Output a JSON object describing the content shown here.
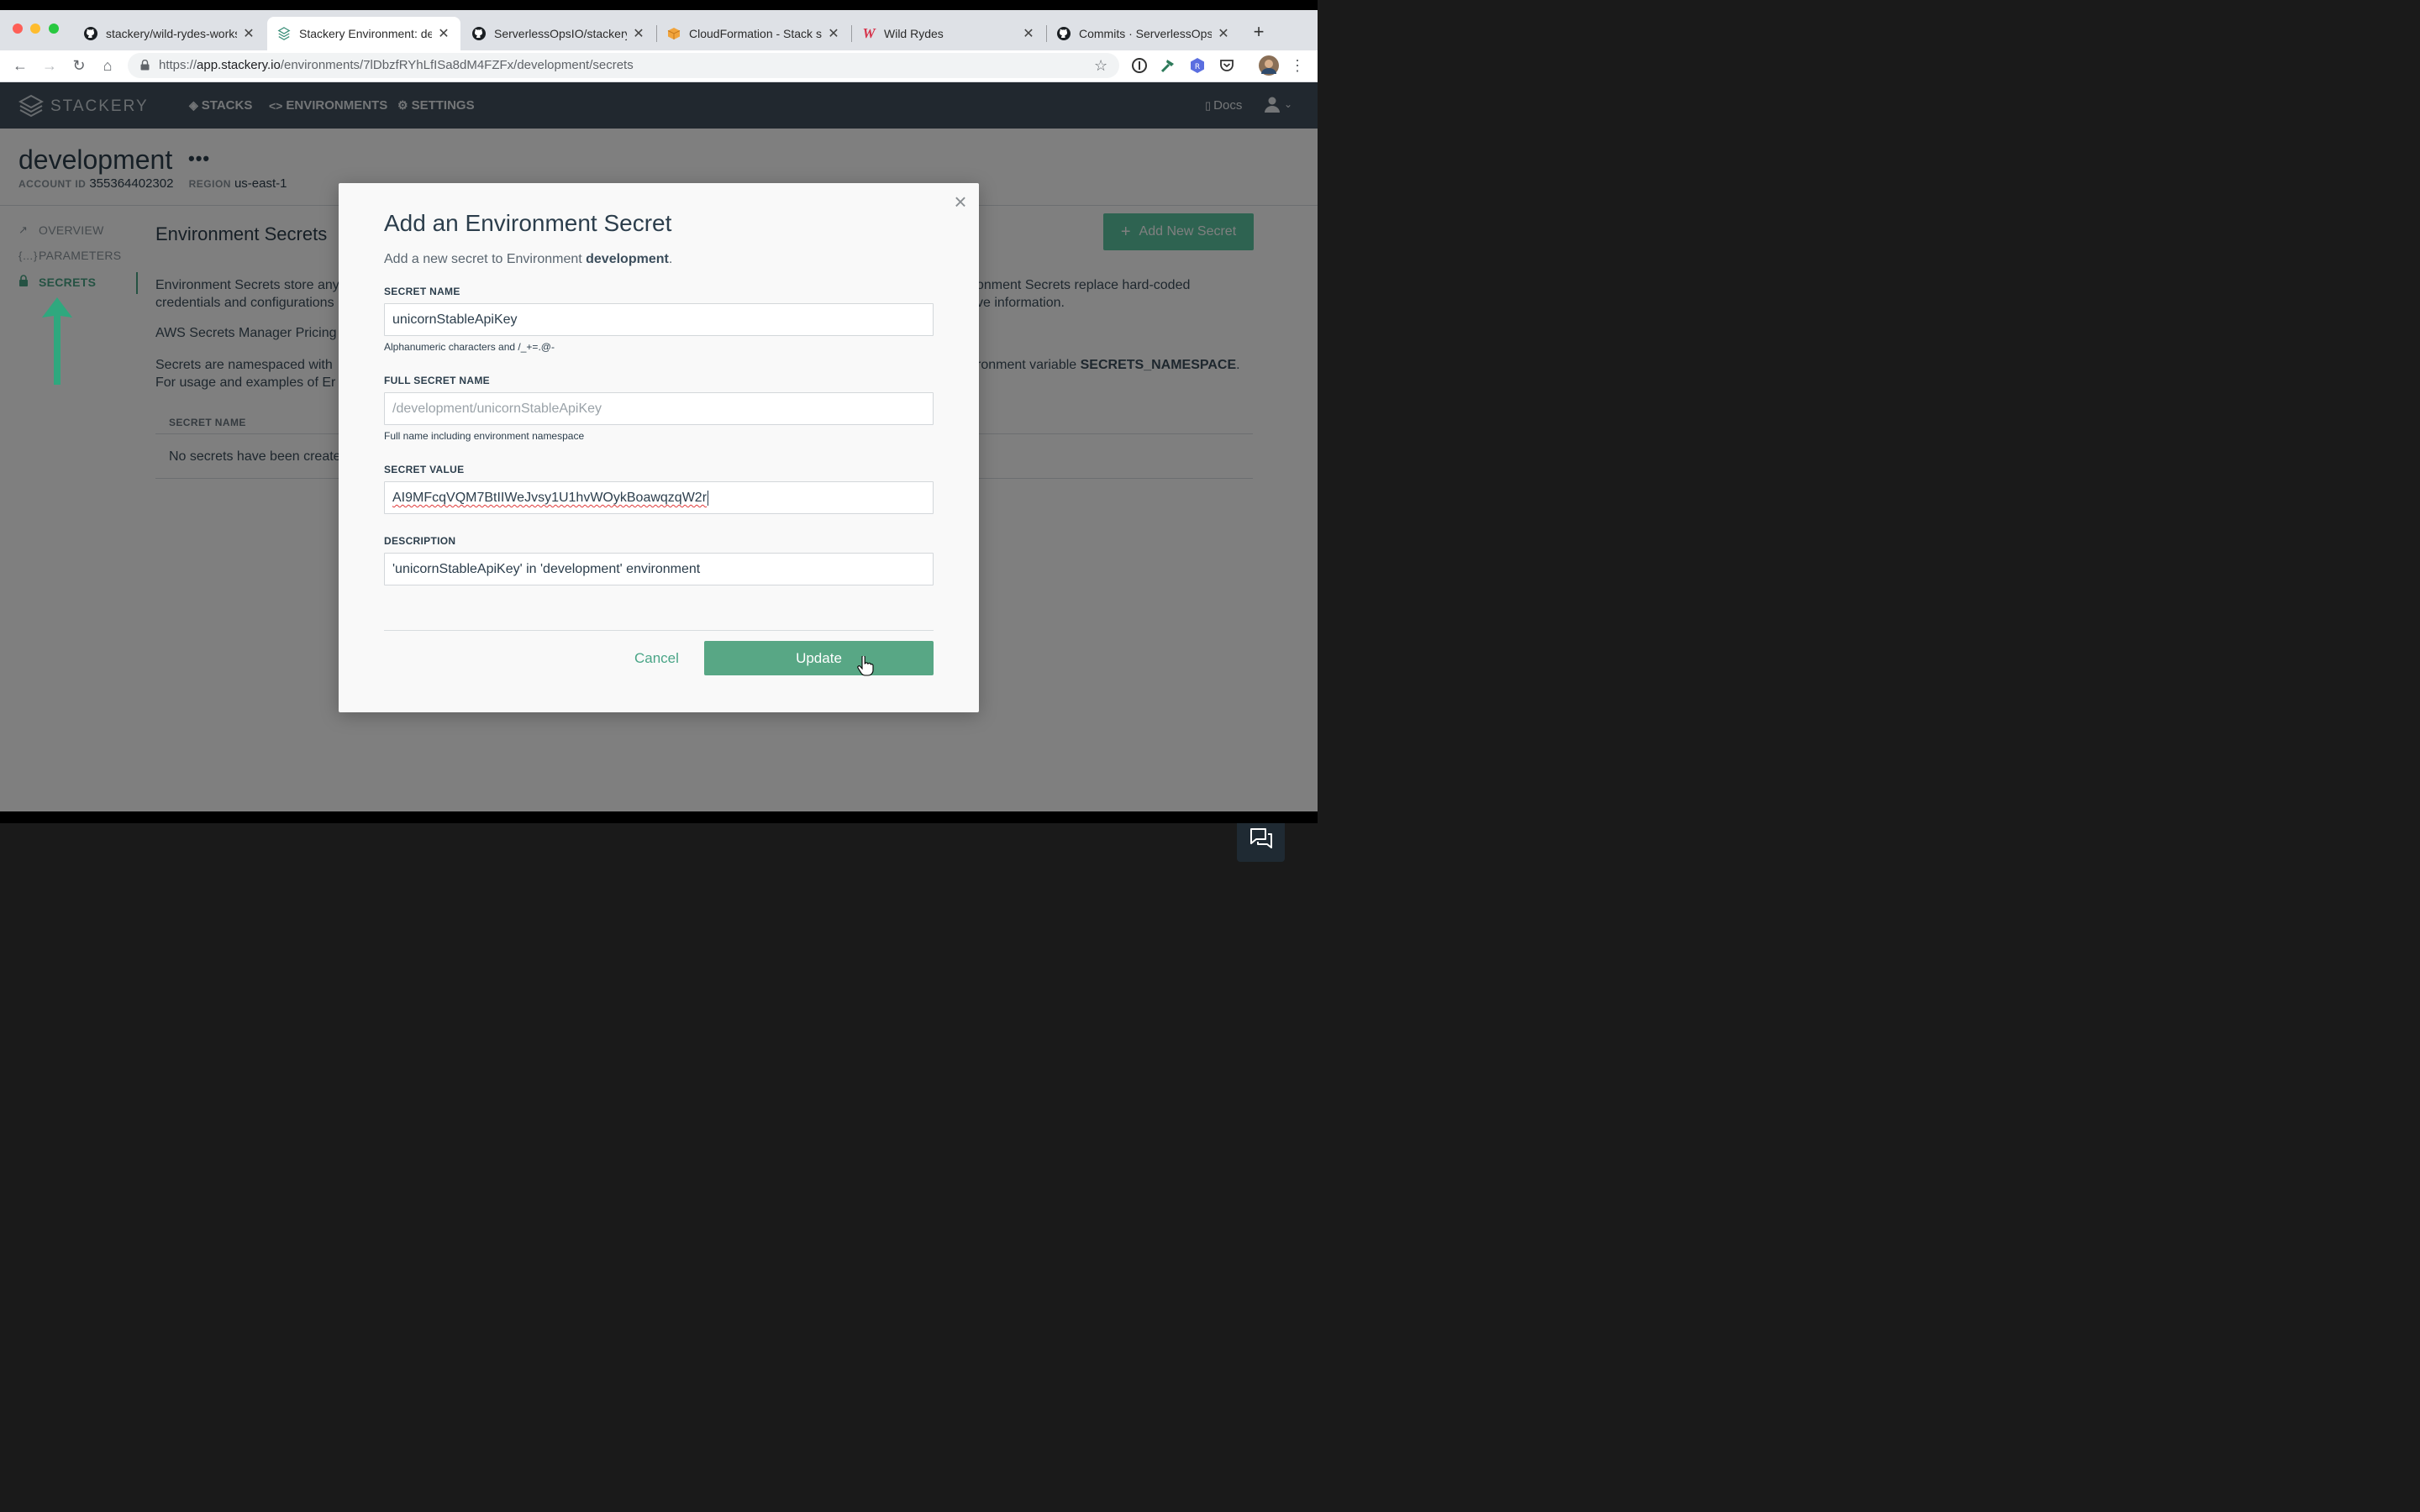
{
  "browser": {
    "tabs": [
      {
        "title": "stackery/wild-rydes-works",
        "icon": "github-icon"
      },
      {
        "title": "Stackery Environment: dev",
        "icon": "stackery-icon"
      },
      {
        "title": "ServerlessOpsIO/stackery",
        "icon": "github-icon"
      },
      {
        "title": "CloudFormation - Stack st",
        "icon": "aws-box-icon"
      },
      {
        "title": "Wild Rydes",
        "icon": "wild-rydes-icon"
      },
      {
        "title": "Commits · ServerlessOpsI",
        "icon": "github-icon"
      }
    ],
    "active_tab": 1,
    "url_prefix": "https://",
    "url_host": "app.stackery.io",
    "url_path": "/environments/7lDbzfRYhLfISa8dM4FZFx/development/secrets"
  },
  "app": {
    "brand": "STACKERY",
    "nav": {
      "stacks": "STACKS",
      "environments": "ENVIRONMENTS",
      "settings": "SETTINGS"
    },
    "docs": "Docs"
  },
  "env": {
    "name": "development",
    "menu": "•••",
    "account_label": "ACCOUNT ID",
    "account_id": "355364402302",
    "region_label": "REGION",
    "region": "us-east-1"
  },
  "sidebar": {
    "overview": "OVERVIEW",
    "parameters": "PARAMETERS",
    "secrets": "SECRETS"
  },
  "secrets_page": {
    "title": "Environment Secrets",
    "add_button": "Add New Secret",
    "p1_left": "Environment Secrets store any",
    "p1_left2": "credentials and configurations",
    "p1_right": "onment Secrets replace hard-coded",
    "p1_right2": "ve information.",
    "p2_left": "AWS Secrets Manager Pricing",
    "p3_left": "Secrets are namespaced with",
    "p3_left2": "For usage and examples of Er",
    "p3_right": "ronment variable ",
    "p3_right_bold": "SECRETS_NAMESPACE",
    "p3_right_end": ".",
    "col_secret_name": "SECRET NAME",
    "empty": "No secrets have been create"
  },
  "modal": {
    "title": "Add an Environment Secret",
    "subtitle_pre": "Add a new secret to Environment ",
    "subtitle_env": "development",
    "subtitle_post": ".",
    "secret_name_label": "SECRET NAME",
    "secret_name_value": "unicornStableApiKey",
    "secret_name_help": "Alphanumeric characters and /_+=.@-",
    "full_name_label": "FULL SECRET NAME",
    "full_name_value": "/development/unicornStableApiKey",
    "full_name_help": "Full name including environment namespace",
    "secret_value_label": "SECRET VALUE",
    "secret_value": "AI9MFcqVQM7BtIIWeJvsy1U1hvWOykBoawqzqW2r",
    "description_label": "DESCRIPTION",
    "description_value": "'unicornStableApiKey' in 'development' environment",
    "cancel": "Cancel",
    "update": "Update"
  },
  "colors": {
    "accent": "#58a785",
    "nav_bg": "#42515e",
    "arrow": "#2fa87e"
  }
}
